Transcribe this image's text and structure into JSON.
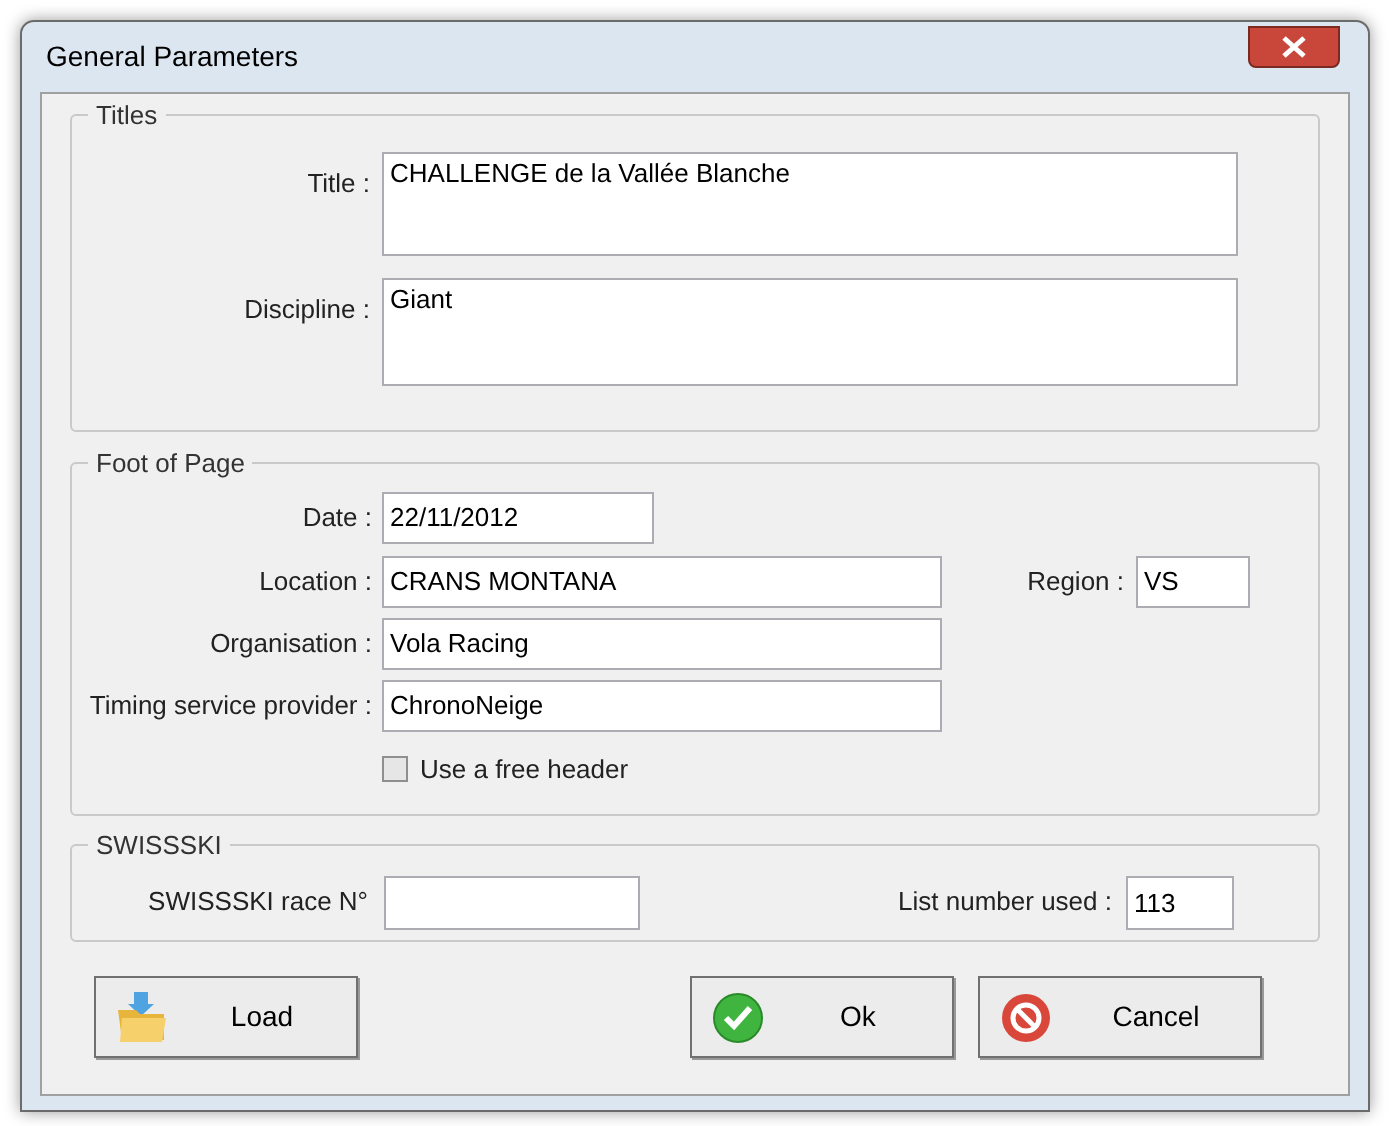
{
  "window": {
    "title": "General Parameters"
  },
  "titles": {
    "legend": "Titles",
    "title": {
      "label": "Title :",
      "value": "CHALLENGE de la Vallée Blanche"
    },
    "discipline": {
      "label": "Discipline :",
      "value": "Giant"
    }
  },
  "foot_of_page": {
    "legend": "Foot of Page",
    "date": {
      "label": "Date :",
      "value": "22/11/2012"
    },
    "location": {
      "label": "Location :",
      "value": "CRANS MONTANA"
    },
    "region": {
      "label": "Region :",
      "value": "VS"
    },
    "organisation": {
      "label": "Organisation :",
      "value": "Vola Racing"
    },
    "timing_provider": {
      "label": "Timing service provider :",
      "value": "ChronoNeige"
    },
    "free_header": {
      "label": "Use a free header",
      "checked": false
    }
  },
  "swissski": {
    "legend": "SWISSSKI",
    "race_number": {
      "label": "SWISSSKI race N°"
    },
    "list_number": {
      "label": "List number used :",
      "value": "113"
    }
  },
  "buttons": [
    {
      "kind": "load",
      "label": "Load"
    },
    {
      "kind": "ok",
      "label": "Ok"
    },
    {
      "kind": "cancel",
      "label": "Cancel"
    }
  ]
}
